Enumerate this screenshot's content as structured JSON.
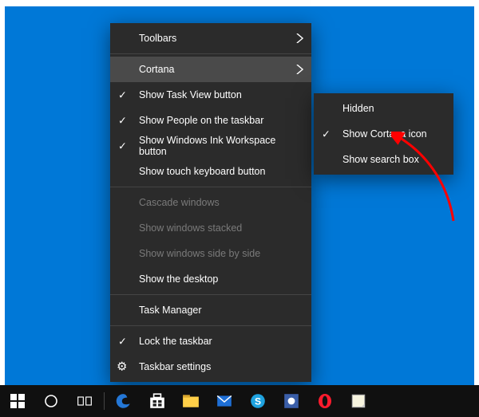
{
  "context_menu": {
    "toolbars": {
      "label": "Toolbars",
      "submenu": true,
      "checked": false,
      "enabled": true
    },
    "cortana": {
      "label": "Cortana",
      "submenu": true,
      "checked": false,
      "enabled": true,
      "highlighted": true
    },
    "task_view": {
      "label": "Show Task View button",
      "checked": true,
      "enabled": true
    },
    "people": {
      "label": "Show People on the taskbar",
      "checked": true,
      "enabled": true
    },
    "ink": {
      "label": "Show Windows Ink Workspace button",
      "checked": true,
      "enabled": true
    },
    "touch_kb": {
      "label": "Show touch keyboard button",
      "checked": false,
      "enabled": true
    },
    "cascade": {
      "label": "Cascade windows",
      "checked": false,
      "enabled": false
    },
    "stacked": {
      "label": "Show windows stacked",
      "checked": false,
      "enabled": false
    },
    "sidebyside": {
      "label": "Show windows side by side",
      "checked": false,
      "enabled": false
    },
    "show_desk": {
      "label": "Show the desktop",
      "checked": false,
      "enabled": true
    },
    "task_mgr": {
      "label": "Task Manager",
      "checked": false,
      "enabled": true
    },
    "lock_tb": {
      "label": "Lock the taskbar",
      "checked": true,
      "enabled": true
    },
    "settings": {
      "label": "Taskbar settings",
      "checked": false,
      "enabled": true,
      "icon": "gear"
    }
  },
  "cortana_submenu": {
    "hidden": {
      "label": "Hidden",
      "checked": false
    },
    "show_icon": {
      "label": "Show Cortana icon",
      "checked": true
    },
    "show_box": {
      "label": "Show search box",
      "checked": false
    }
  },
  "taskbar": {
    "start": {
      "name": "start-button"
    },
    "cortana": {
      "name": "cortana-button"
    },
    "taskview": {
      "name": "task-view-button"
    },
    "apps": [
      {
        "name": "edge-app-icon"
      },
      {
        "name": "store-app-icon"
      },
      {
        "name": "explorer-app-icon"
      },
      {
        "name": "mail-app-icon"
      },
      {
        "name": "skype-app-icon"
      },
      {
        "name": "app-icon"
      },
      {
        "name": "opera-app-icon"
      },
      {
        "name": "sticky-notes-app-icon"
      }
    ]
  },
  "annotation": {
    "color": "#ff0000"
  }
}
